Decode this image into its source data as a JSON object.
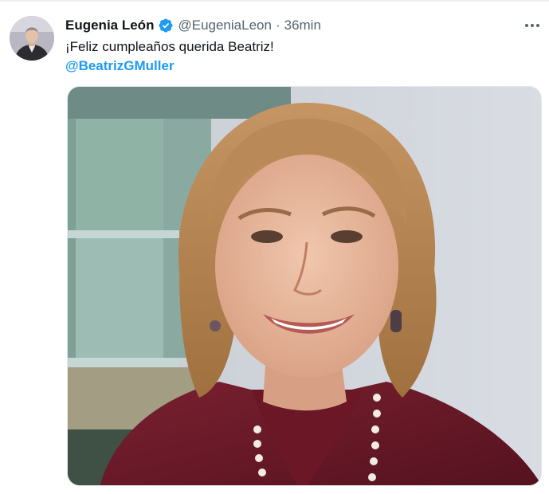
{
  "author": {
    "display_name": "Eugenia León",
    "handle": "@EugeniaLeon",
    "separator": "·",
    "time": "36min",
    "verified_icon": "verified-badge-icon",
    "verified_color": "#1d9bf0"
  },
  "tweet": {
    "text": "¡Feliz cumpleaños querida Beatriz!",
    "mention": "@BeatrizGMuller",
    "mention_color": "#1d9bf0"
  },
  "menu": {
    "icon": "more-options-icon"
  },
  "media": {
    "subject_label": "Beatriz Gutiérrez Müller smiling, shoulder-length blonde hair, maroon top and pearl necklace"
  },
  "colors": {
    "text_primary": "#0f1419",
    "text_secondary": "#536471",
    "accent": "#1d9bf0"
  }
}
